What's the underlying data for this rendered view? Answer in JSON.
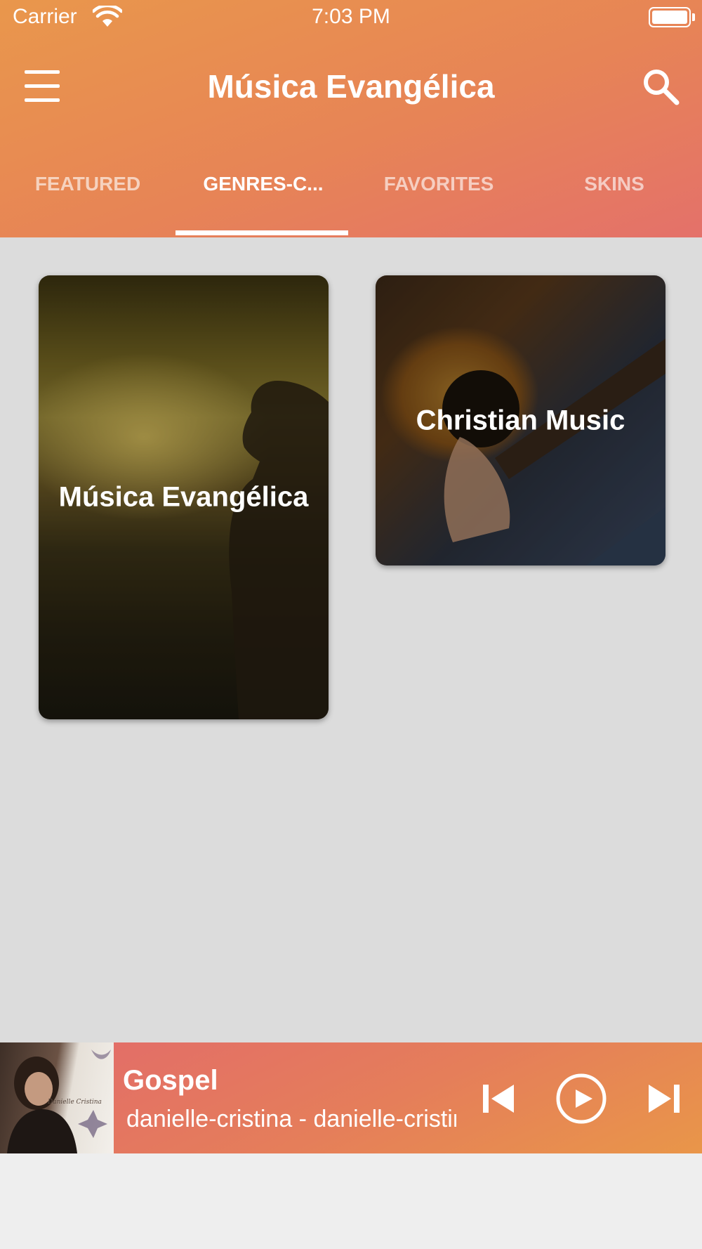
{
  "status_bar": {
    "carrier": "Carrier",
    "time": "7:03 PM",
    "icons": [
      "wifi-icon",
      "battery-icon"
    ]
  },
  "header": {
    "title": "Música Evangélica",
    "menu_icon": "hamburger-menu-icon",
    "search_icon": "search-icon",
    "gradient": [
      "#e9974c",
      "#e4716a"
    ]
  },
  "tabs": [
    {
      "label": "FEATURED",
      "active": false
    },
    {
      "label": "GENRES-C...",
      "active": true
    },
    {
      "label": "FAVORITES",
      "active": false
    },
    {
      "label": "SKINS",
      "active": false
    }
  ],
  "genres": [
    {
      "title": "Música Evangélica"
    },
    {
      "title": "Christian Music"
    }
  ],
  "player": {
    "title": "Gospel",
    "subtitle": "danielle-cristina - danielle-cristina",
    "album_art_text": "Danielle Cristina",
    "controls": [
      "skip-previous-icon",
      "play-icon",
      "skip-next-icon"
    ],
    "gradient": [
      "#e26a6b",
      "#e99649"
    ]
  }
}
